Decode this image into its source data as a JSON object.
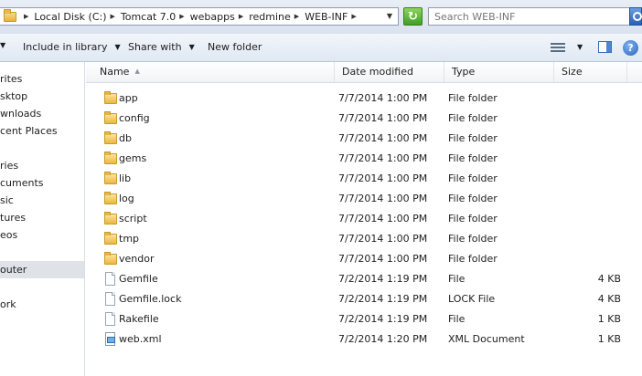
{
  "address": {
    "breadcrumbs": [
      "Local Disk (C:)",
      "Tomcat 7.0",
      "webapps",
      "redmine",
      "WEB-INF"
    ]
  },
  "search": {
    "placeholder": "Search WEB-INF"
  },
  "toolbar": {
    "include_in_library": "Include in library",
    "share_with": "Share with",
    "new_folder": "New folder"
  },
  "nav": {
    "items": [
      {
        "label": "rites",
        "selected": false
      },
      {
        "label": "sktop",
        "selected": false
      },
      {
        "label": "wnloads",
        "selected": false
      },
      {
        "label": "cent Places",
        "selected": false
      },
      {
        "label": "ries",
        "selected": false
      },
      {
        "label": "cuments",
        "selected": false
      },
      {
        "label": "sic",
        "selected": false
      },
      {
        "label": "tures",
        "selected": false
      },
      {
        "label": "eos",
        "selected": false
      },
      {
        "label": "outer",
        "selected": true
      },
      {
        "label": "ork",
        "selected": false
      }
    ]
  },
  "columns": {
    "name": "Name",
    "date_modified": "Date modified",
    "type": "Type",
    "size": "Size"
  },
  "files": [
    {
      "name": "app",
      "date": "7/7/2014 1:00 PM",
      "type": "File folder",
      "size": "",
      "icon": "folder"
    },
    {
      "name": "config",
      "date": "7/7/2014 1:00 PM",
      "type": "File folder",
      "size": "",
      "icon": "folder"
    },
    {
      "name": "db",
      "date": "7/7/2014 1:00 PM",
      "type": "File folder",
      "size": "",
      "icon": "folder"
    },
    {
      "name": "gems",
      "date": "7/7/2014 1:00 PM",
      "type": "File folder",
      "size": "",
      "icon": "folder"
    },
    {
      "name": "lib",
      "date": "7/7/2014 1:00 PM",
      "type": "File folder",
      "size": "",
      "icon": "folder"
    },
    {
      "name": "log",
      "date": "7/7/2014 1:00 PM",
      "type": "File folder",
      "size": "",
      "icon": "folder"
    },
    {
      "name": "script",
      "date": "7/7/2014 1:00 PM",
      "type": "File folder",
      "size": "",
      "icon": "folder"
    },
    {
      "name": "tmp",
      "date": "7/7/2014 1:00 PM",
      "type": "File folder",
      "size": "",
      "icon": "folder"
    },
    {
      "name": "vendor",
      "date": "7/7/2014 1:00 PM",
      "type": "File folder",
      "size": "",
      "icon": "folder"
    },
    {
      "name": "Gemfile",
      "date": "7/2/2014 1:19 PM",
      "type": "File",
      "size": "4 KB",
      "icon": "file"
    },
    {
      "name": "Gemfile.lock",
      "date": "7/2/2014 1:19 PM",
      "type": "LOCK File",
      "size": "4 KB",
      "icon": "file"
    },
    {
      "name": "Rakefile",
      "date": "7/2/2014 1:19 PM",
      "type": "File",
      "size": "1 KB",
      "icon": "file"
    },
    {
      "name": "web.xml",
      "date": "7/2/2014 1:20 PM",
      "type": "XML Document",
      "size": "1 KB",
      "icon": "xml"
    }
  ]
}
